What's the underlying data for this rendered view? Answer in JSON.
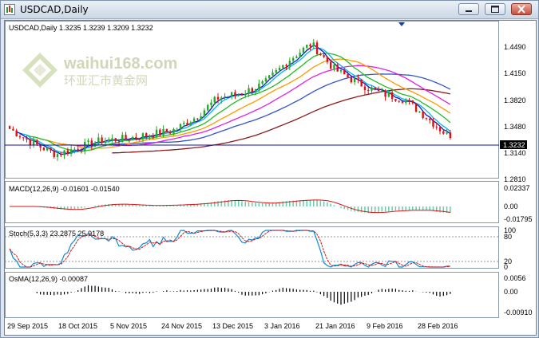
{
  "window": {
    "title": "USDCAD,Daily",
    "buttons": [
      "minimize",
      "maximize",
      "close"
    ]
  },
  "main_panel": {
    "info": "USDCAD,Daily  1.3235 1.3239 1.3209 1.3232",
    "price_ticks": [
      "1.4490",
      "1.4150",
      "1.3820",
      "1.3480",
      "1.3140",
      "1.2810"
    ],
    "current_price": "1.3232",
    "watermark_name": "waihui168.com",
    "watermark_cn": "环亚汇市黄金网"
  },
  "macd_panel": {
    "label": "MACD(12,26,9) -0.01601 -0.01540",
    "ticks": [
      "0.02337",
      "0.00",
      "-0.01795"
    ]
  },
  "stoch_panel": {
    "label": "Stoch(5,3,3) 23.2875 25.9178",
    "ticks": [
      "100",
      "80",
      "20",
      "0"
    ]
  },
  "osma_panel": {
    "label": "OsMA(12,26,9) -0.00087",
    "ticks": [
      "0.0056",
      "0.00",
      "-0.00910"
    ]
  },
  "date_axis": [
    "29 Sep 2015",
    "18 Oct 2015",
    "5 Nov 2015",
    "24 Nov 2015",
    "13 Dec 2015",
    "3 Jan 2016",
    "21 Jan 2016",
    "9 Feb 2016",
    "28 Feb 2016"
  ],
  "colors": {
    "bull": "#22aa22",
    "bear": "#dd1111",
    "ma_fast": "#1010cc",
    "ma_cyan": "#00b8e8",
    "ma_green": "#22bb22",
    "ma_orange": "#ff9900",
    "ma_magenta": "#e020e0",
    "ma_blue": "#3355cc",
    "ma_dark": "#8b1a1a",
    "stoch_main": "#0d8ad6",
    "stoch_signal": "#dd1111",
    "histogram": "#66ccaa"
  },
  "chart_data": {
    "type": "candlestick",
    "symbol": "USDCAD",
    "timeframe": "Daily",
    "last_bar": {
      "open": 1.3235,
      "high": 1.3239,
      "low": 1.3209,
      "close": 1.3232
    },
    "price_range": [
      1.275,
      1.468
    ],
    "price_path": [
      {
        "date": "29 Sep 2015",
        "close": 1.336
      },
      {
        "date": "3 Oct 2015",
        "close": 1.316
      },
      {
        "date": "10 Oct 2015",
        "close": 1.3
      },
      {
        "date": "18 Oct 2015",
        "close": 1.31
      },
      {
        "date": "25 Oct 2015",
        "close": 1.32
      },
      {
        "date": "5 Nov 2015",
        "close": 1.322
      },
      {
        "date": "15 Nov 2015",
        "close": 1.328
      },
      {
        "date": "24 Nov 2015",
        "close": 1.333
      },
      {
        "date": "5 Dec 2015",
        "close": 1.352
      },
      {
        "date": "13 Dec 2015",
        "close": 1.38
      },
      {
        "date": "22 Dec 2015",
        "close": 1.386
      },
      {
        "date": "3 Jan 2016",
        "close": 1.4
      },
      {
        "date": "10 Jan 2016",
        "close": 1.432
      },
      {
        "date": "16 Jan 2016",
        "close": 1.456
      },
      {
        "date": "21 Jan 2016",
        "close": 1.42
      },
      {
        "date": "29 Jan 2016",
        "close": 1.401
      },
      {
        "date": "9 Feb 2016",
        "close": 1.386
      },
      {
        "date": "20 Feb 2016",
        "close": 1.378
      },
      {
        "date": "28 Feb 2016",
        "close": 1.352
      },
      {
        "date": "6 Mar 2016",
        "close": 1.3232
      }
    ]
  }
}
